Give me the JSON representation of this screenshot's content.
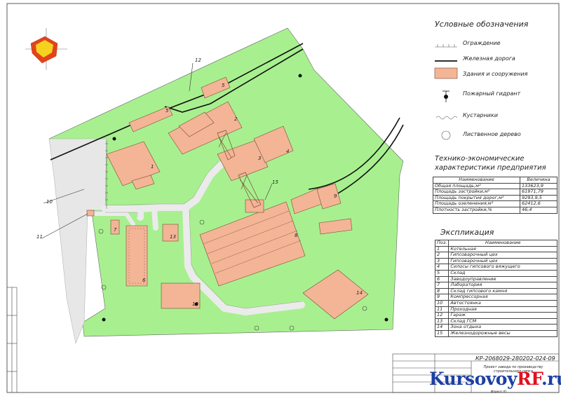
{
  "legend": {
    "title": "Условные обозначения",
    "items": [
      {
        "label": "Ограждение",
        "icon": "fence-icon"
      },
      {
        "label": "Железная дорога",
        "icon": "railway-icon"
      },
      {
        "label": "Здания и сооружения",
        "icon": "building-swatch-icon"
      },
      {
        "label": "Пожарный гидрант",
        "icon": "hydrant-icon"
      },
      {
        "label": "Кустарники",
        "icon": "shrub-icon"
      },
      {
        "label": "Лиственное дерево",
        "icon": "tree-icon"
      }
    ]
  },
  "tech": {
    "title_line1": "Технико-экономические",
    "title_line2": "характеристики предприятия",
    "headers": [
      "Наименование",
      "Величина"
    ],
    "rows": [
      [
        "Общая площадь,м²",
        "133623,9"
      ],
      [
        "Площадь застройки,м²",
        "61971,79"
      ],
      [
        "Площадь покрытия дорог,м²",
        "9293,9,5"
      ],
      [
        "Площадь озеленения,м²",
        "62412,6"
      ],
      [
        "Плотность застройки,%",
        "46,4"
      ]
    ]
  },
  "explication": {
    "title": "Экспликация",
    "headers": [
      "Поз.",
      "Наименование"
    ],
    "rows": [
      [
        "1",
        "Котельная"
      ],
      [
        "2",
        "Гипсоварочный цех"
      ],
      [
        "3",
        "Гипсоварочный цех"
      ],
      [
        "4",
        "Силосы гипсового вяжущего"
      ],
      [
        "5",
        "Склад"
      ],
      [
        "6",
        "Заводоуправление"
      ],
      [
        "7",
        "Лаборатория"
      ],
      [
        "8",
        "Склад гипсового камня"
      ],
      [
        "9",
        "Компрессорная"
      ],
      [
        "10",
        "Автостоянка"
      ],
      [
        "11",
        "Проходная"
      ],
      [
        "12",
        "Гараж"
      ],
      [
        "13",
        "Склад ГСМ"
      ],
      [
        "14",
        "Зона отдыха"
      ],
      [
        "15",
        "Железнодорожные весы"
      ]
    ]
  },
  "stamp": {
    "code": "КР-2068029-280202-024-09",
    "description": "Проект завода по производству строительного гипса",
    "sheet": "Формат А1"
  },
  "map": {
    "labels": [
      "1",
      "2",
      "3",
      "4",
      "5",
      "5",
      "6",
      "7",
      "8",
      "9",
      "10",
      "11",
      "12",
      "12",
      "13",
      "14",
      "15"
    ]
  },
  "watermark": {
    "main": "Kursovoy",
    "accent": "RF",
    "suffix": ".ru"
  },
  "colors": {
    "green": "#a8f08f",
    "building": "#f3b596",
    "road": "#ebebeb",
    "rail": "#111111"
  }
}
